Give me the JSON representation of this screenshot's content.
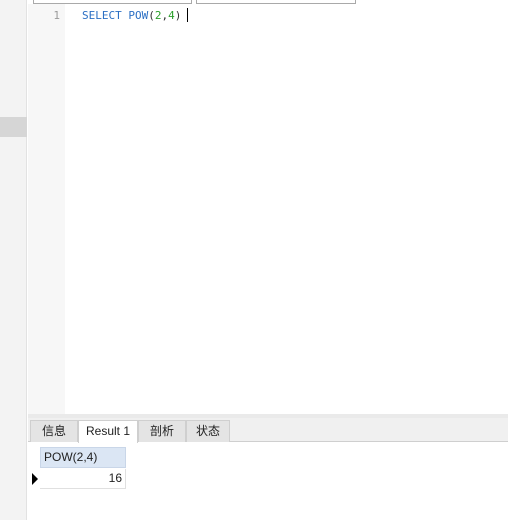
{
  "editor": {
    "line_number": "1",
    "tokens": {
      "keyword": "SELECT",
      "function": "POW",
      "open_paren": "(",
      "arg1": "2",
      "comma": ",",
      "arg2": "4",
      "close_paren": ")"
    }
  },
  "tabs": [
    {
      "label": "信息",
      "active": false
    },
    {
      "label": "Result 1",
      "active": true
    },
    {
      "label": "剖析",
      "active": false
    },
    {
      "label": "状态",
      "active": false
    }
  ],
  "result": {
    "columns": [
      "POW(2,4)"
    ],
    "rows": [
      [
        "16"
      ]
    ]
  },
  "colors": {
    "keyword": "#2b6fc4",
    "number": "#2a9e2a",
    "header_bg": "#dbe6f4"
  }
}
